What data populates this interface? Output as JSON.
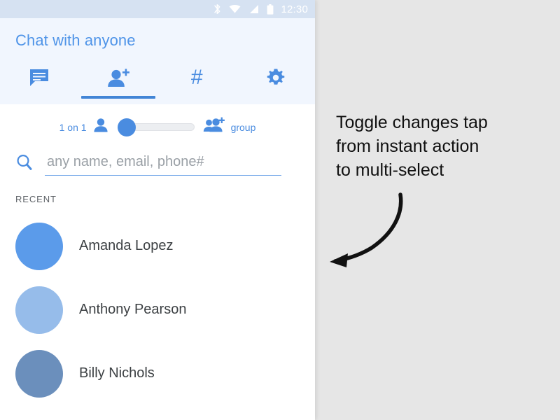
{
  "status_bar": {
    "time": "12:30",
    "icons": [
      "bluetooth-icon",
      "wifi-icon",
      "cellular-signal-icon",
      "battery-icon"
    ],
    "background_color": "#d6e2f2",
    "foreground_color": "#ffffff"
  },
  "header": {
    "title": "Chat with anyone",
    "title_color": "#4f94e8",
    "background_color": "#f1f6fe"
  },
  "tabs": [
    {
      "name": "conversations",
      "icon": "chat-bubble-icon",
      "active": false
    },
    {
      "name": "new-contact",
      "icon": "person-add-icon",
      "active": true
    },
    {
      "name": "channels",
      "icon": "hashtag-icon",
      "glyph": "#",
      "active": false
    },
    {
      "name": "settings",
      "icon": "gear-icon",
      "active": false
    }
  ],
  "tab_accent_color": "#4285d6",
  "toggle": {
    "left_label": "1 on 1",
    "left_icon": "person-icon",
    "right_icon": "group-add-icon",
    "right_label": "group",
    "state": "left",
    "thumb_color": "#4a8ce0",
    "track_color": "#eceef1"
  },
  "search": {
    "icon": "search-icon",
    "value": "",
    "placeholder": "any name, email, phone#",
    "underline_color": "#6fa4e8"
  },
  "recent": {
    "section_label": "RECENT",
    "contacts": [
      {
        "name": "Amanda Lopez",
        "avatar_color": "#5b9bea"
      },
      {
        "name": "Anthony Pearson",
        "avatar_color": "#96bcea"
      },
      {
        "name": "Billy Nichols",
        "avatar_color": "#6b8fbc"
      }
    ]
  },
  "annotation": {
    "line1": "Toggle changes tap",
    "line2": "from instant action",
    "line3": "to multi-select",
    "arrow": "curved-arrow-icon",
    "text_color": "#101010"
  },
  "canvas": {
    "background_color": "#e6e6e6",
    "panel_background_color": "#ffffff"
  }
}
